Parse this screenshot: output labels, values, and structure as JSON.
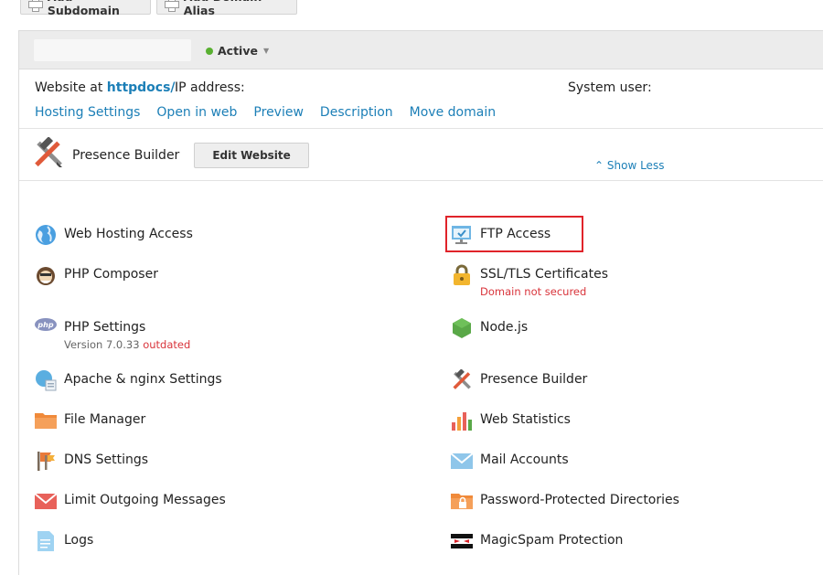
{
  "toolbar": {
    "add_subdomain": "Add Subdomain",
    "add_domain_alias": "Add Domain Alias"
  },
  "domain": {
    "status": "Active",
    "website_at_prefix": "Website at",
    "website_dir": "httpdocs/",
    "ip_label": "IP address:",
    "system_user_label": "System user:"
  },
  "links": [
    "Hosting Settings",
    "Open in web",
    "Preview",
    "Description",
    "Move domain"
  ],
  "presence_builder": {
    "label": "Presence Builder",
    "edit_button": "Edit Website"
  },
  "show_less": "Show Less",
  "left_items": [
    {
      "label": "Web Hosting Access",
      "icon": "globe-icon"
    },
    {
      "label": "PHP Composer",
      "icon": "composer-icon"
    },
    {
      "label": "PHP Settings",
      "icon": "php-icon",
      "sub_prefix": "Version 7.0.33",
      "sub_warn": "outdated"
    },
    {
      "label": "Apache & nginx Settings",
      "icon": "server-settings-icon"
    },
    {
      "label": "File Manager",
      "icon": "folder-icon"
    },
    {
      "label": "DNS Settings",
      "icon": "dns-flag-icon"
    },
    {
      "label": "Limit Outgoing Messages",
      "icon": "envelope-icon"
    },
    {
      "label": "Logs",
      "icon": "log-document-icon"
    }
  ],
  "right_items": [
    {
      "label": "FTP Access",
      "icon": "ftp-folder-icon"
    },
    {
      "label": "SSL/TLS Certificates",
      "icon": "lock-icon",
      "sub": "Domain not secured"
    },
    {
      "label": "Node.js",
      "icon": "nodejs-hexagon-icon"
    },
    {
      "label": "Presence Builder",
      "icon": "hammer-tools-icon"
    },
    {
      "label": "Web Statistics",
      "icon": "bar-chart-icon"
    },
    {
      "label": "Mail Accounts",
      "icon": "mail-icon"
    },
    {
      "label": "Password-Protected Directories",
      "icon": "locked-folder-icon"
    },
    {
      "label": "MagicSpam Protection",
      "icon": "magicspam-ninja-icon"
    }
  ],
  "colors": {
    "link": "#1c7fb7",
    "active_dot": "#59b031",
    "warning": "#d9343b",
    "highlight": "#e0232a"
  }
}
